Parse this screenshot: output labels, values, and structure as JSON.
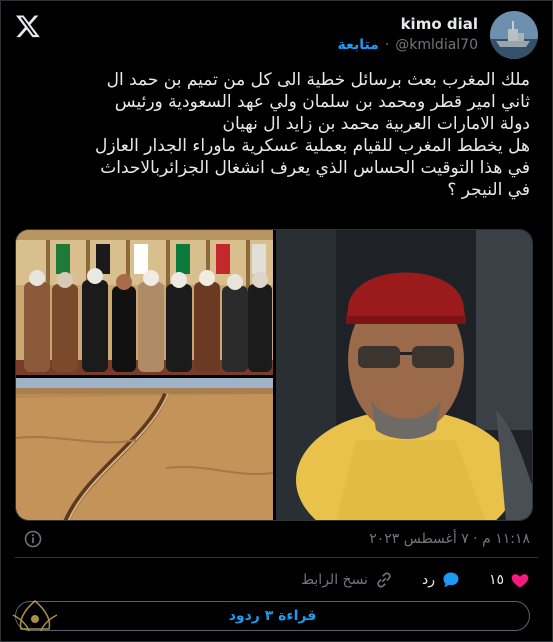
{
  "user": {
    "name": "kimo dial",
    "handle": "@kmldial70",
    "follow_label": "متابعة",
    "separator": "·"
  },
  "tweet": {
    "lines": [
      "ملك المغرب بعث برسائل خطية الى كل من تميم بن حمد ال",
      "ثاني امير  قطر ومحمد بن سلمان ولي عهد السعودية ورئيس",
      "دولة الامارات العربية  محمد بن زايد ال نهيان",
      "هل يخطط المغرب للقيام بعملية عسكرية ماوراء الجدار العازل",
      "في هذا التوقيت الحساس الذي يعرف انشغال الجزائربالاحداث",
      "في النيجر ؟"
    ],
    "timestamp": "١١:١٨ م · ٧ أغسطس ٢٠٢٣"
  },
  "media": {
    "count": 3
  },
  "actions": {
    "like_count": "١٥",
    "reply_label": "رد",
    "copy_link_label": "نسخ الرابط"
  },
  "read_replies_label": "قراءة ٣ ردود",
  "icons": {
    "logo": "x-logo-icon",
    "info": "info-icon",
    "like": "heart-icon",
    "reply": "speech-bubble-icon",
    "link": "link-icon"
  },
  "colors": {
    "accent": "#1d9bf0",
    "like": "#f91880",
    "muted": "#71767b",
    "text": "#e7e9ea",
    "background": "#000000"
  }
}
